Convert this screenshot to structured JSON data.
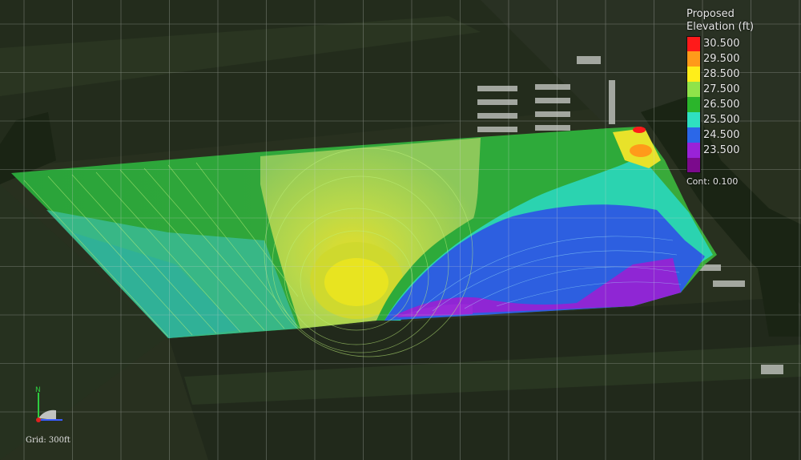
{
  "legend": {
    "title_line1": "Proposed",
    "title_line2": "Elevation (ft)",
    "items": [
      {
        "label": "30.500",
        "color": "#ff1a1a"
      },
      {
        "label": "29.500",
        "color": "#ff9a1a"
      },
      {
        "label": "28.500",
        "color": "#ffee1a"
      },
      {
        "label": "27.500",
        "color": "#8fe34a"
      },
      {
        "label": "26.500",
        "color": "#2bb52b"
      },
      {
        "label": "25.500",
        "color": "#2fe0c0"
      },
      {
        "label": "24.500",
        "color": "#2b67e8"
      },
      {
        "label": "23.500",
        "color": "#9a22d8"
      },
      {
        "label": "",
        "color": "#7b0a8c"
      }
    ],
    "contour_note": "Cont: 0.100"
  },
  "triad": {
    "north_label": "N"
  },
  "grid": {
    "label": "Grid: 300ft"
  }
}
